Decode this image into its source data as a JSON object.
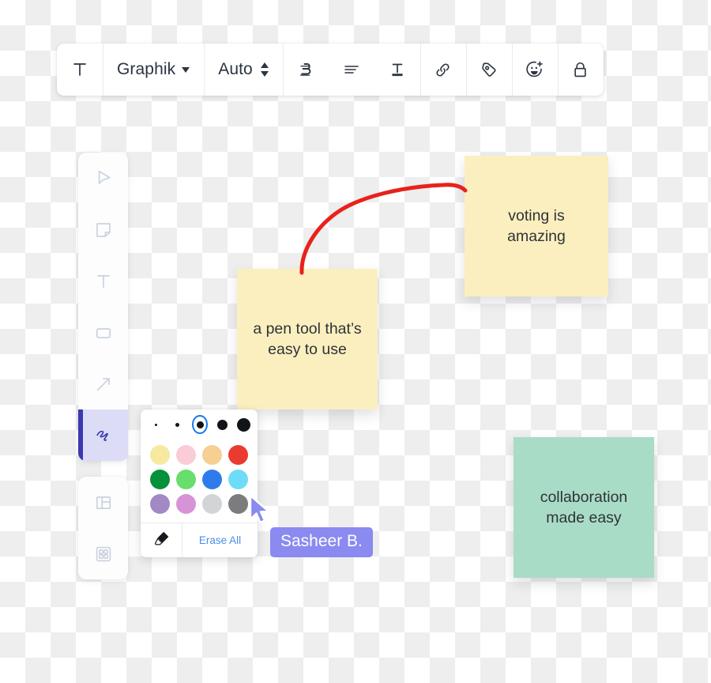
{
  "format_toolbar": {
    "text_style_icon": "text-format-icon",
    "font": {
      "label": "Graphik",
      "caret_icon": "chevron-down-icon"
    },
    "size": {
      "label": "Auto",
      "stepper_icon": "stepper-updown-icon"
    },
    "bold_icon": "bold-italic-underline-icon",
    "align_icon": "text-align-icon",
    "vertical_align_icon": "vertical-align-bottom-icon",
    "link_icon": "link-icon",
    "tag_icon": "tag-icon",
    "reaction_icon": "emoji-add-icon",
    "lock_icon": "lock-icon"
  },
  "tool_palette": {
    "items": [
      {
        "name": "select",
        "icon": "cursor-arrow-icon",
        "active": false
      },
      {
        "name": "sticky-note",
        "icon": "sticky-note-icon",
        "active": false
      },
      {
        "name": "text",
        "icon": "text-t-icon",
        "active": false
      },
      {
        "name": "shape",
        "icon": "rectangle-icon",
        "active": false
      },
      {
        "name": "arrow",
        "icon": "arrow-diagonal-icon",
        "active": false
      },
      {
        "name": "pen",
        "icon": "pen-scribble-icon",
        "active": true
      }
    ],
    "secondary_items": [
      {
        "name": "frame",
        "icon": "frame-layout-icon",
        "active": false
      },
      {
        "name": "apps",
        "icon": "grid-apps-icon",
        "active": false
      }
    ]
  },
  "pen_popover": {
    "stroke_sizes": [
      {
        "size": 3,
        "selected": false
      },
      {
        "size": 5,
        "selected": false
      },
      {
        "size": 9,
        "selected": true
      },
      {
        "size": 13,
        "selected": false
      },
      {
        "size": 17,
        "selected": false
      }
    ],
    "colors": [
      "#f7e9a0",
      "#f9ccd7",
      "#f6cf93",
      "#ea3b30",
      "#059139",
      "#68de6c",
      "#2e7cec",
      "#6ddcf7",
      "#a389c4",
      "#d694d6",
      "#d2d4d6",
      "#7c7c7e"
    ],
    "eraser_icon": "eraser-icon",
    "erase_all_label": "Erase All",
    "accent_color": "#4a90e8",
    "selection_ring_color": "#1878e8"
  },
  "canvas": {
    "sticky_notes": [
      {
        "id": "voting",
        "text": "voting is amazing",
        "color": "#fcefbf"
      },
      {
        "id": "pen",
        "text": "a pen tool that’s easy to use",
        "color": "#fcefbf"
      },
      {
        "id": "collab",
        "text": "collaboration made easy",
        "color": "#a9dcc6"
      }
    ],
    "ink_stroke": {
      "name": "red-curve-connector",
      "color": "#e8221b",
      "width": 5
    }
  },
  "collaborator": {
    "name": "Sasheer B.",
    "cursor_icon": "cursor-pointer-icon",
    "color": "#8a8af0"
  }
}
